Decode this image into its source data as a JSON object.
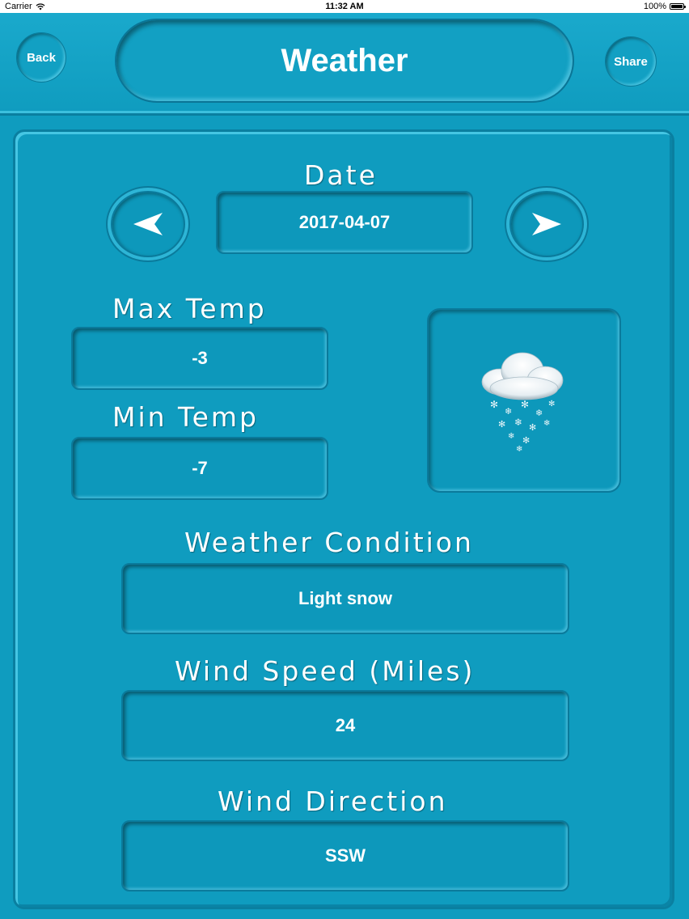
{
  "status_bar": {
    "carrier": "Carrier",
    "time": "11:32 AM",
    "battery": "100%"
  },
  "header": {
    "back_label": "Back",
    "title": "Weather",
    "share_label": "Share"
  },
  "date": {
    "label": "Date",
    "value": "2017-04-07"
  },
  "max_temp": {
    "label": "Max Temp",
    "value": "-3"
  },
  "min_temp": {
    "label": "Min Temp",
    "value": "-7"
  },
  "condition": {
    "label": "Weather Condition",
    "value": "Light snow",
    "icon": "snow-cloud-icon"
  },
  "wind_speed": {
    "label": "Wind Speed (Miles)",
    "value": "24"
  },
  "wind_direction": {
    "label": "Wind Direction",
    "value": "SSW"
  },
  "colors": {
    "background": "#0f9cbf",
    "text": "#ffffff",
    "border": "#0a7a9b"
  }
}
